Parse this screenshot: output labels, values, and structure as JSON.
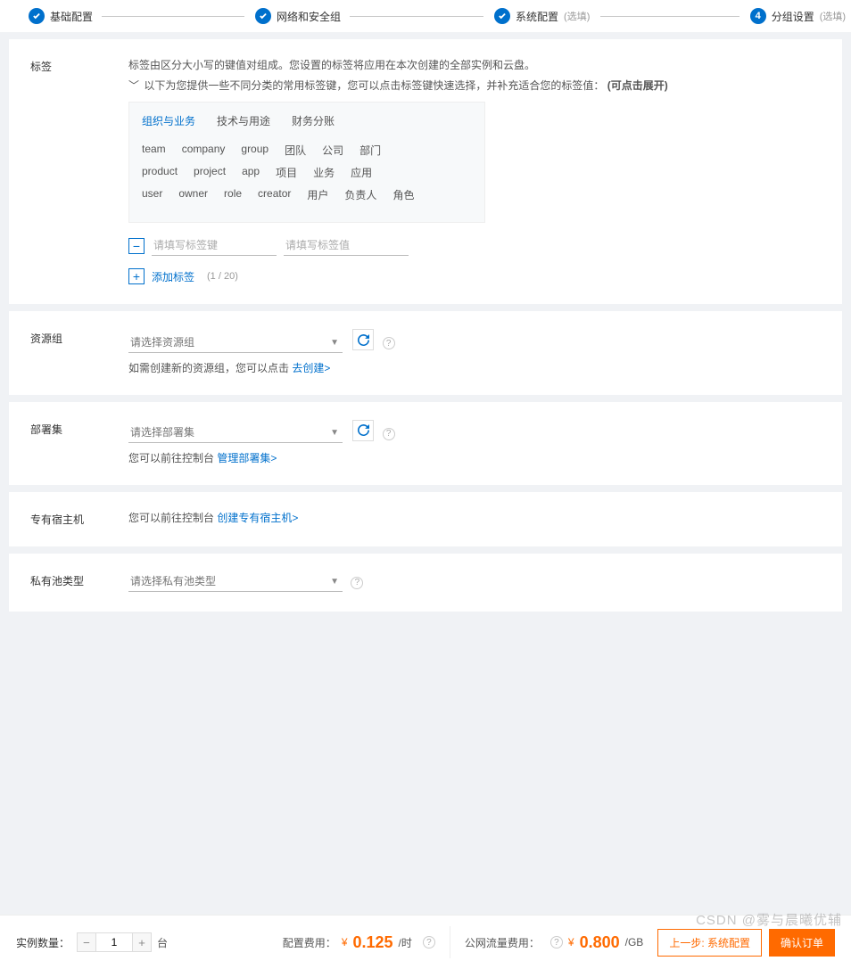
{
  "steps": {
    "s1": "基础配置",
    "s2": "网络和安全组",
    "s3": "系统配置",
    "s3_opt": "(选填)",
    "s4_num": "4",
    "s4": "分组设置",
    "s4_opt": "(选填)"
  },
  "tag": {
    "label": "标签",
    "desc": "标签由区分大小写的键值对组成。您设置的标签将应用在本次创建的全部实例和云盘。",
    "expandPrefix": "以下为您提供一些不同分类的常用标签键，您可以点击标签键快速选择，并补充适合您的标签值：",
    "expandBold": "(可点击展开)",
    "tabs": {
      "t1": "组织与业务",
      "t2": "技术与用途",
      "t3": "财务分账"
    },
    "row1": [
      "team",
      "company",
      "group",
      "团队",
      "公司",
      "部门"
    ],
    "row2": [
      "product",
      "project",
      "app",
      "项目",
      "业务",
      "应用"
    ],
    "row3": [
      "user",
      "owner",
      "role",
      "creator",
      "用户",
      "负责人",
      "角色"
    ],
    "keyPh": "请填写标签键",
    "valPh": "请填写标签值",
    "add": "添加标签",
    "count": "(1 / 20)"
  },
  "resGroup": {
    "label": "资源组",
    "selectPh": "请选择资源组",
    "desc1": "如需创建新的资源组，您可以点击 ",
    "link": "去创建>"
  },
  "deploy": {
    "label": "部署集",
    "selectPh": "请选择部署集",
    "desc1": "您可以前往控制台 ",
    "link": "管理部署集>"
  },
  "ddh": {
    "label": "专有宿主机",
    "desc1": "您可以前往控制台 ",
    "link": "创建专有宿主机>"
  },
  "pool": {
    "label": "私有池类型",
    "selectPh": "请选择私有池类型"
  },
  "footer": {
    "qtyLabel": "实例数量：",
    "qty": "1",
    "unit": "台",
    "feeLabel": "配置费用：",
    "currency": "¥",
    "price": "0.125",
    "per": "/时",
    "netLabel": "公网流量费用：",
    "netPrice": "0.800",
    "netPer": "/GB",
    "back": "上一步: 系统配置",
    "next": "确认订单"
  },
  "watermark": "CSDN @雾与晨曦优辅",
  "help": "?"
}
